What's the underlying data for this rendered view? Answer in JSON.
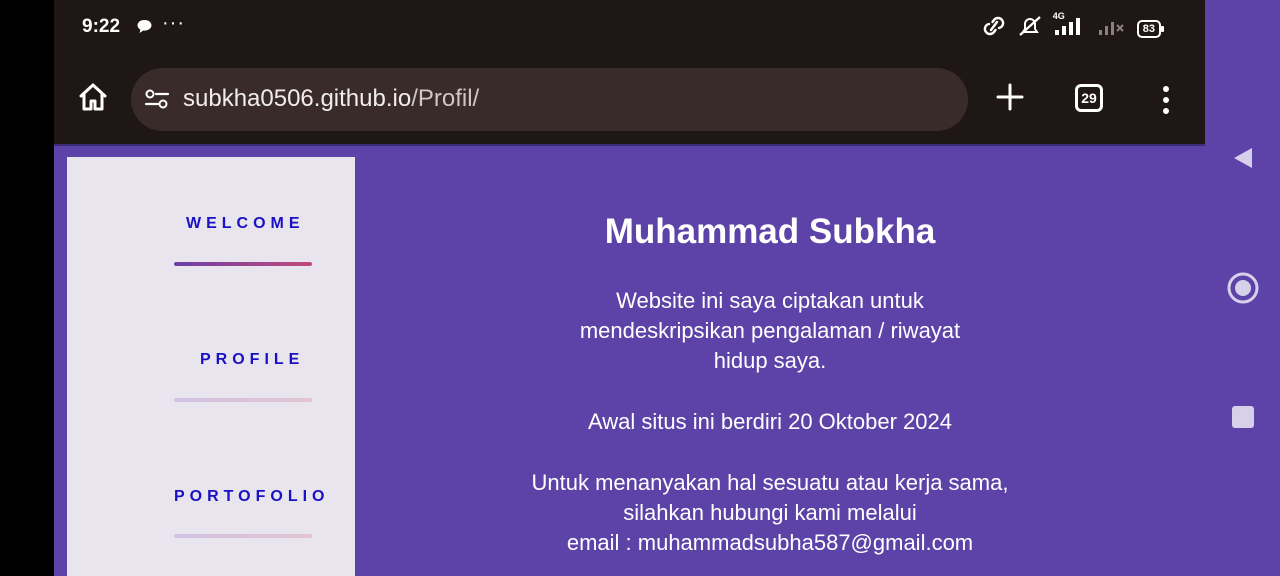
{
  "status_bar": {
    "time": "9:22",
    "more": "···",
    "network": "4G",
    "battery": "83"
  },
  "browser": {
    "url_domain": "subkha0506.github.io",
    "url_path": "/Profil/",
    "tab_count": "29"
  },
  "sidebar": {
    "items": [
      {
        "label": "WELCOME",
        "active": true
      },
      {
        "label": "PROFILE",
        "active": false
      },
      {
        "label": "PORTOFOLIO",
        "active": false
      }
    ]
  },
  "main": {
    "title": "Muhammad Subkha",
    "description": [
      "Website ini saya ciptakan untuk",
      "mendeskripsikan pengalaman / riwayat",
      "hidup saya."
    ],
    "founded": "Awal situs ini berdiri 20 Oktober 2024",
    "contact": [
      "Untuk menanyakan hal sesuatu atau kerja sama,",
      "silahkan hubungi kami melalui",
      "email : muhammadsubha587@gmail.com"
    ]
  },
  "colors": {
    "page_bg": "#5d43a7",
    "sidebar_bg": "#e8e5ef",
    "nav_text": "#1a10c4",
    "browser_chrome": "#1f1616"
  }
}
